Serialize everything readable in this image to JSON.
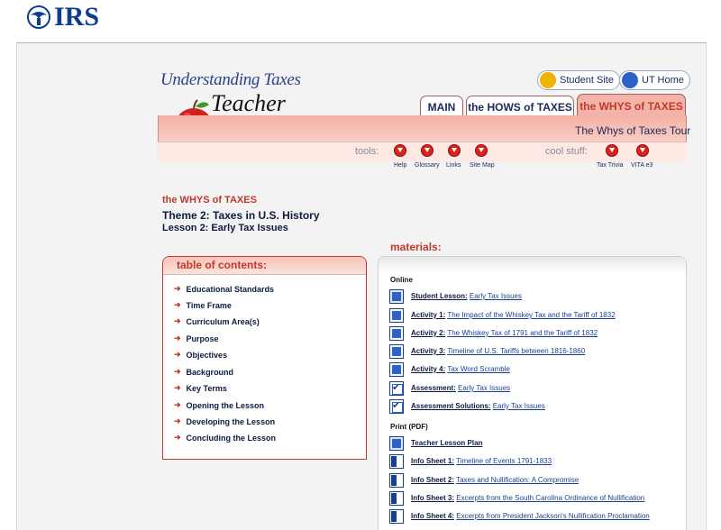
{
  "top": {
    "logo_text": "IRS"
  },
  "brand": {
    "line1": "Understanding Taxes",
    "line2": "Teacher"
  },
  "header_links": {
    "student_site": "Student Site",
    "ut_home": "UT Home"
  },
  "tabs": {
    "main": "MAIN",
    "hows": "the HOWS of TAXES",
    "whys": "the WHYS of TAXES"
  },
  "tour": "The Whys of Taxes Tour",
  "tools": {
    "tools_label": "tools:",
    "cool_label": "cool stuff:",
    "items": [
      "Help",
      "Glossary",
      "Links",
      "Site Map"
    ],
    "cool_items": [
      "Tax Trivia",
      "VITA e3"
    ]
  },
  "content": {
    "section_small": "the WHYS of TAXES",
    "theme": "Theme 2: Taxes in U.S. History",
    "lesson": "Lesson 2: Early Tax Issues",
    "materials_title": "materials:"
  },
  "toc": {
    "title": "table of contents:",
    "items": [
      "Educational Standards",
      "Time Frame",
      "Curriculum Area(s)",
      "Purpose",
      "Objectives",
      "Background",
      "Key Terms",
      "Opening the Lesson",
      "Developing the Lesson",
      "Concluding the Lesson"
    ]
  },
  "materials": {
    "online_label": "Online",
    "print_label": "Print (PDF)",
    "online": [
      {
        "label": "Student Lesson:",
        "value": "Early Tax Issues",
        "icon": "lesson-icon"
      },
      {
        "label": "Activity 1:",
        "value": "The Impact of the Whiskey Tax and the Tariff of 1832",
        "icon": "activity-icon"
      },
      {
        "label": "Activity 2:",
        "value": "The Whiskey Tax of 1791 and the Tariff of 1832",
        "icon": "activity-icon"
      },
      {
        "label": "Activity 3:",
        "value": "Timeline of U.S. Tariffs between 1816-1860",
        "icon": "activity-icon"
      },
      {
        "label": "Activity 4:",
        "value": "Tax Word Scramble",
        "icon": "activity-icon"
      },
      {
        "label": "Assessment:",
        "value": "Early Tax Issues",
        "icon": "checkbox-icon"
      },
      {
        "label": "Assessment Solutions:",
        "value": "Early Tax Issues",
        "icon": "checkbox-icon"
      }
    ],
    "print": [
      {
        "label": "Teacher Lesson Plan",
        "value": "",
        "icon": "lesson-icon"
      },
      {
        "label": "Info Sheet 1:",
        "value": "Timeline of Events 1791-1833",
        "icon": "document-icon"
      },
      {
        "label": "Info Sheet 2:",
        "value": "Taxes and Nullification: A Compromise",
        "icon": "document-icon"
      },
      {
        "label": "Info Sheet 3:",
        "value": "Excerpts from the South Carolina Ordinance of Nullification",
        "icon": "document-icon"
      },
      {
        "label": "Info Sheet 4:",
        "value": "Excerpts from President Jackson's Nullification Proclamation",
        "icon": "document-icon"
      }
    ]
  },
  "colors": {
    "accent_red": "#c0392b",
    "navy": "#1a2a5a",
    "salmon": "#f4b0a4",
    "link_blue": "#1a3f8f"
  }
}
